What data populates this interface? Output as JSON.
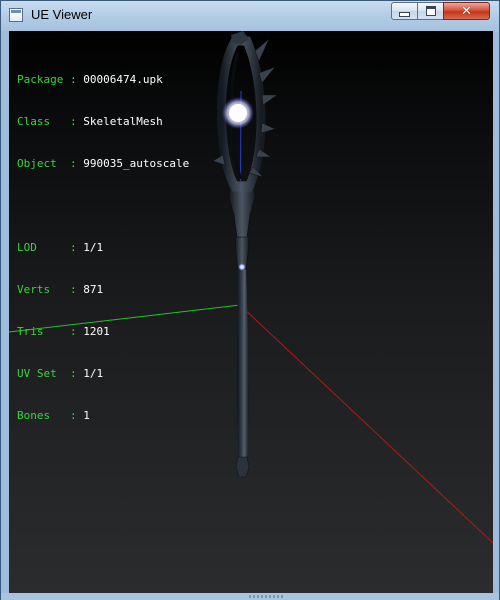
{
  "window": {
    "title": "UE Viewer",
    "controls": {
      "minimize_icon": "minimize-icon",
      "maximize_icon": "maximize-icon",
      "close_icon": "close-icon",
      "close_glyph": "✕"
    }
  },
  "info": {
    "package": {
      "label": "Package",
      "sep": " : ",
      "value": "00006474.upk"
    },
    "class": {
      "label": "Class  ",
      "sep": " : ",
      "value": "SkeletalMesh"
    },
    "object": {
      "label": "Object ",
      "sep": " : ",
      "value": "990035_autoscale"
    },
    "lod": {
      "label": "LOD    ",
      "sep": " : ",
      "value": "1/1"
    },
    "verts": {
      "label": "Verts  ",
      "sep": " : ",
      "value": "871"
    },
    "tris": {
      "label": "Tris   ",
      "sep": " : ",
      "value": "1201"
    },
    "uvset": {
      "label": "UV Set ",
      "sep": " : ",
      "value": "1/1"
    },
    "bones": {
      "label": "Bones  ",
      "sep": " : ",
      "value": "1"
    }
  },
  "colors": {
    "label_green": "#3ed23e",
    "value_white": "#ffffff",
    "axis_x": "#b01818",
    "axis_y": "#22c422",
    "axis_z": "#2840c8",
    "glow": "#ffffff"
  },
  "scene": {
    "model": "staff-mesh",
    "axes": [
      "x-axis",
      "y-axis",
      "z-axis"
    ]
  }
}
